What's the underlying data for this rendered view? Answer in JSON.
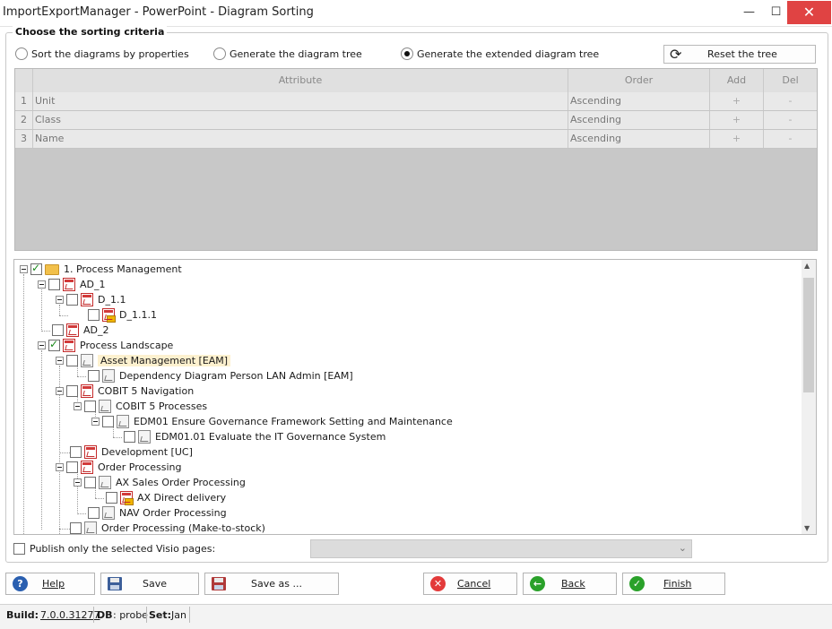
{
  "window": {
    "title": "ImportExportManager - PowerPoint - Diagram Sorting"
  },
  "group": {
    "title": "Choose the sorting criteria"
  },
  "options": [
    {
      "label": "Sort the diagrams by properties",
      "selected": false
    },
    {
      "label": "Generate the diagram tree",
      "selected": false
    },
    {
      "label": "Generate the extended diagram tree",
      "selected": true
    }
  ],
  "reset": {
    "label": "Reset the tree",
    "icon": "refresh-icon"
  },
  "grid": {
    "columns": [
      "Attribute",
      "Order",
      "Add",
      "Del"
    ],
    "rows": [
      {
        "num": "1",
        "attribute": "Unit",
        "order": "Ascending",
        "add": "+",
        "del": "-"
      },
      {
        "num": "2",
        "attribute": "Class",
        "order": "Ascending",
        "add": "+",
        "del": "-"
      },
      {
        "num": "3",
        "attribute": "Name",
        "order": "Ascending",
        "add": "+",
        "del": "-"
      }
    ]
  },
  "tree": [
    {
      "label": "1. Process Management",
      "icon": "folder-icon",
      "checked": true
    },
    {
      "label": "AD_1",
      "icon": "red-diagram-icon",
      "checked": false
    },
    {
      "label": "D_1.1",
      "icon": "red-diagram-icon",
      "checked": false
    },
    {
      "label": "D_1.1.1",
      "icon": "red-badge-diagram-icon",
      "checked": false
    },
    {
      "label": "AD_2",
      "icon": "red-diagram-icon",
      "checked": false
    },
    {
      "label": "Process Landscape",
      "icon": "red-diagram-icon",
      "checked": true
    },
    {
      "label": "Asset Management  [EAM]",
      "icon": "gray-diagram-icon",
      "checked": false,
      "highlighted": true
    },
    {
      "label": "Dependency Diagram Person LAN Admin  [EAM]",
      "icon": "gray-diagram-icon",
      "checked": false
    },
    {
      "label": "COBIT 5 Navigation",
      "icon": "red-diagram-icon",
      "checked": false
    },
    {
      "label": "COBIT 5 Processes",
      "icon": "gray-diagram-icon",
      "checked": false
    },
    {
      "label": "EDM01 Ensure Governance Framework Setting and Maintenance",
      "icon": "gray-diagram-icon",
      "checked": false
    },
    {
      "label": "EDM01.01 Evaluate the IT Governance System",
      "icon": "gray-diagram-icon",
      "checked": false
    },
    {
      "label": "Development [UC]",
      "icon": "red-diagram-icon",
      "checked": false
    },
    {
      "label": "Order Processing",
      "icon": "red-diagram-icon",
      "checked": false
    },
    {
      "label": "AX Sales Order Processing",
      "icon": "gray-diagram-icon",
      "checked": false
    },
    {
      "label": "AX Direct delivery",
      "icon": "red-badge-diagram-icon",
      "checked": false
    },
    {
      "label": "NAV Order Processing",
      "icon": "gray-diagram-icon",
      "checked": false
    },
    {
      "label": "Order Processing (Make-to-stock)",
      "icon": "gray-diagram-icon",
      "checked": false
    }
  ],
  "publish": {
    "label": "Publish only the selected Visio pages:",
    "checked": false
  },
  "buttons": {
    "help": "Help",
    "save": "Save",
    "save_as": "Save as ...",
    "cancel": "Cancel",
    "back": "Back",
    "finish": "Finish"
  },
  "status": {
    "build_label": "Build:",
    "build_value": "7.0.0.31277",
    "db_label": "DB",
    "db_value": ": probe",
    "set_label": "Set:",
    "set_value": "Jan"
  },
  "colors": {
    "close": "#e04343",
    "cancel": "#e33a3a",
    "back": "#2aa12a",
    "finish": "#2aa12a",
    "help": "#2a5fb0"
  }
}
